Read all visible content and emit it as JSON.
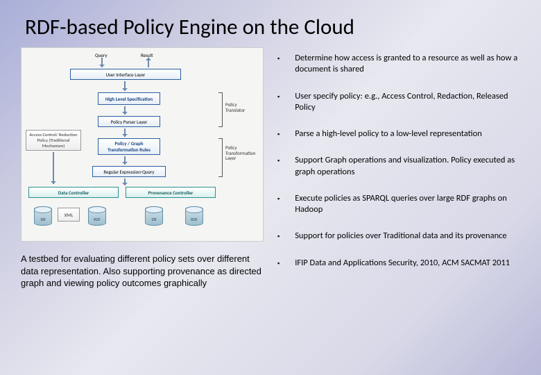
{
  "title": "RDF-based Policy Engine on the Cloud",
  "diagram": {
    "query": "Query",
    "result": "Result",
    "ui_layer": "User Interface Layer",
    "high_level_spec": "High Level Specification",
    "policy_parser": "Policy Parser Layer",
    "acr_policy": "Access Control/ Reduction Policy (Traditional Mechanism)",
    "policy_graph_rules": "Policy / Graph Transformation Rules",
    "regex_query": "Regular Expression-Query",
    "data_controller": "Data Controller",
    "prov_controller": "Provenance Controller",
    "db1": "DB",
    "xml": "XML",
    "rdf1": "RDF",
    "db2": "DB",
    "rdf2": "RDF",
    "label_policy_translator": "Policy Translator",
    "label_policy_transform": "Policy Transformation Layer"
  },
  "caption": "A testbed for evaluating different policy sets over different data representation. Also supporting provenance as directed graph and viewing policy outcomes graphically",
  "bullets": [
    "Determine how access is granted to a resource as well as how a document is shared",
    "User specify policy: e.g., Access Control, Redaction, Released Policy",
    "Parse a high-level policy to a low-level representation",
    "Support Graph operations and visualization. Policy executed as graph operations",
    "Execute policies as SPARQL queries over large RDF graphs on Hadoop",
    "Support for policies over Traditional data and its provenance",
    "IFIP Data and Applications Security, 2010, ACM SACMAT 2011"
  ]
}
